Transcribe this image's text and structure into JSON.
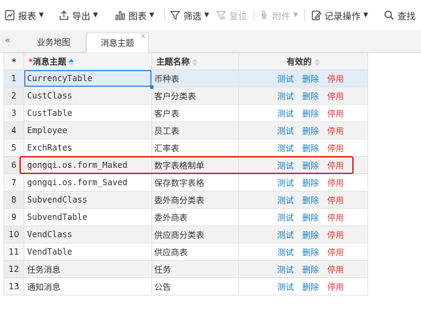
{
  "toolbar": {
    "items": [
      {
        "label": "报表",
        "icon": "report-icon",
        "has_caret": true,
        "disabled": false
      },
      {
        "label": "导出",
        "icon": "export-icon",
        "has_caret": true,
        "disabled": false
      },
      {
        "label": "图表",
        "icon": "chart-icon",
        "has_caret": true,
        "disabled": false
      },
      {
        "label": "筛选",
        "icon": "filter-icon",
        "has_caret": true,
        "disabled": false
      },
      {
        "label": "复位",
        "icon": "reset-filter-icon",
        "has_caret": false,
        "disabled": true
      },
      {
        "label": "附件",
        "icon": "attachment-icon",
        "has_caret": true,
        "disabled": true
      },
      {
        "label": "记录操作",
        "icon": "record-operation-icon",
        "has_caret": true,
        "disabled": false
      },
      {
        "label": "查找",
        "icon": "search-icon",
        "has_caret": false,
        "disabled": false
      }
    ]
  },
  "tabs": [
    {
      "label": "业务地图",
      "active": false
    },
    {
      "label": "消息主题",
      "active": true
    }
  ],
  "tab_close_glyph": "×",
  "collapse_glyph": "«",
  "grid": {
    "corner": "*",
    "columns": {
      "topic": {
        "required_mark": "*",
        "label": "消息主题"
      },
      "name": {
        "label": "主题名称"
      },
      "valid": {
        "label": "有效的"
      }
    },
    "actions": {
      "test": "测试",
      "delete": "删除",
      "disable": "停用"
    },
    "rows": [
      {
        "index": "1",
        "topic": "CurrencyTable",
        "name": "币种表"
      },
      {
        "index": "2",
        "topic": "CustClass",
        "name": "客户分类表"
      },
      {
        "index": "3",
        "topic": "CustTable",
        "name": "客户表"
      },
      {
        "index": "4",
        "topic": "Employee",
        "name": "员工表"
      },
      {
        "index": "5",
        "topic": "ExchRates",
        "name": "汇率表"
      },
      {
        "index": "6",
        "topic": "gongqi.os.form_Maked",
        "name": "数字表格制单"
      },
      {
        "index": "7",
        "topic": "gongqi.os.form_Saved",
        "name": "保存数字表格"
      },
      {
        "index": "8",
        "topic": "SubvendClass",
        "name": "委外商分类表"
      },
      {
        "index": "9",
        "topic": "SubvendTable",
        "name": "委外商表"
      },
      {
        "index": "10",
        "topic": "VendClass",
        "name": "供应商分类表"
      },
      {
        "index": "11",
        "topic": "VendTable",
        "name": "供应商表"
      },
      {
        "index": "12",
        "topic": "任务消息",
        "name": "任务"
      },
      {
        "index": "13",
        "topic": "通知消息",
        "name": "公告"
      }
    ]
  },
  "colors": {
    "accent": "#1a7fc8",
    "danger": "#e4393c",
    "highlight_box": "#e02020",
    "selection": "#e1ecf7"
  }
}
